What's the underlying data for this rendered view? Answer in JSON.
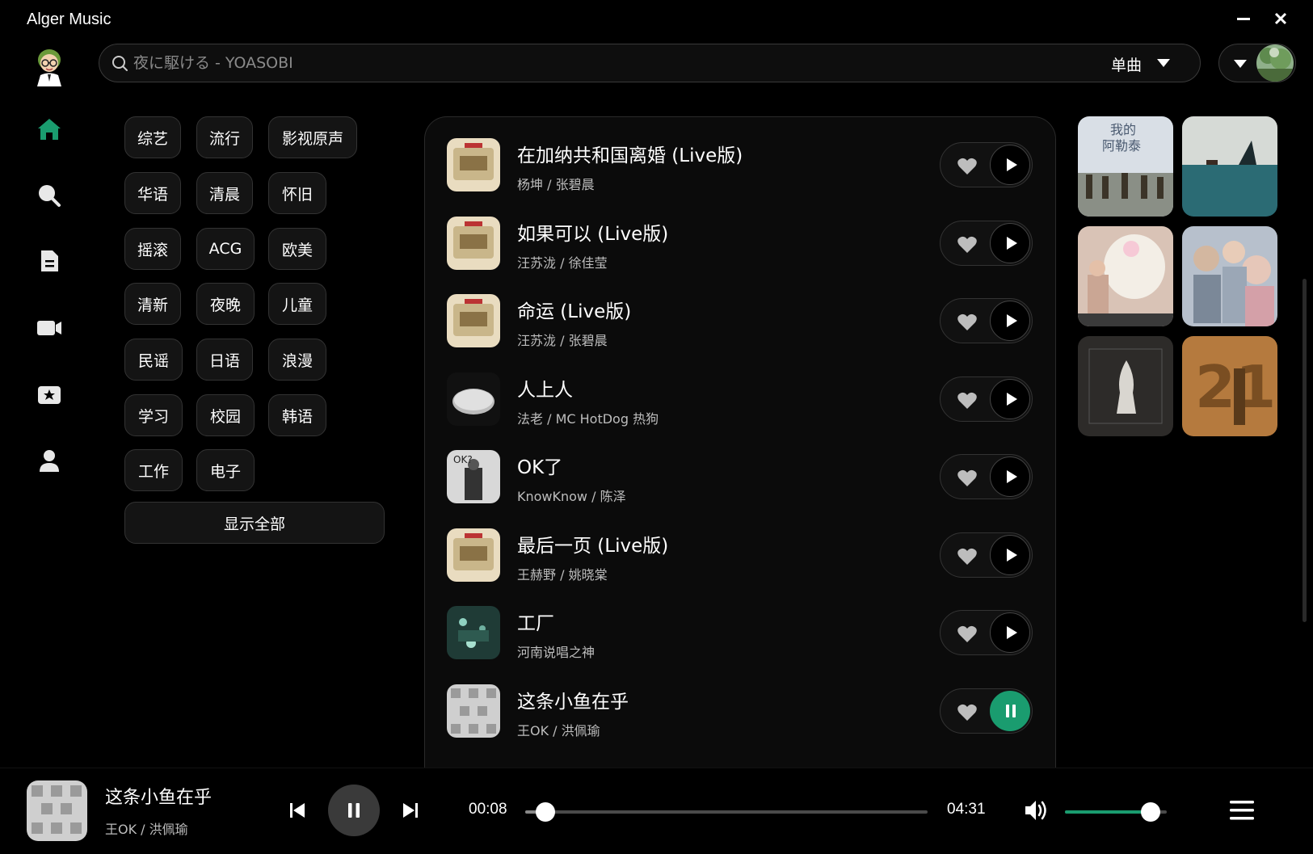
{
  "app": {
    "title": "Alger Music"
  },
  "search": {
    "placeholder": "夜に駆ける - YOASOBI",
    "type_label": "单曲"
  },
  "nav": {
    "items": [
      {
        "name": "home",
        "active": true
      },
      {
        "name": "search",
        "active": false
      },
      {
        "name": "playlist",
        "active": false
      },
      {
        "name": "mv",
        "active": false
      },
      {
        "name": "favorites",
        "active": false
      },
      {
        "name": "user",
        "active": false
      }
    ],
    "active_color": "#1a9c6f"
  },
  "tags": [
    "综艺",
    "流行",
    "影视原声",
    "华语",
    "清晨",
    "怀旧",
    "摇滚",
    "ACG",
    "欧美",
    "清新",
    "夜晚",
    "儿童",
    "民谣",
    "日语",
    "浪漫",
    "学习",
    "校园",
    "韩语",
    "工作",
    "电子"
  ],
  "show_all_label": "显示全部",
  "songs": [
    {
      "title": "在加纳共和国离婚 (Live版)",
      "artist": "杨坤 / 张碧晨",
      "playing": false
    },
    {
      "title": "如果可以 (Live版)",
      "artist": "汪苏泷 / 徐佳莹",
      "playing": false
    },
    {
      "title": "命运 (Live版)",
      "artist": "汪苏泷 / 张碧晨",
      "playing": false
    },
    {
      "title": "人上人",
      "artist": "法老 / MC HotDog 热狗",
      "playing": false
    },
    {
      "title": "OK了",
      "artist": "KnowKnow / 陈泽",
      "playing": false
    },
    {
      "title": "最后一页 (Live版)",
      "artist": "王赫野 / 姚晓棠",
      "playing": false
    },
    {
      "title": "工厂",
      "artist": "河南说唱之神",
      "playing": false
    },
    {
      "title": "这条小鱼在乎",
      "artist": "王OK / 洪佩瑜",
      "playing": true
    }
  ],
  "albums": [
    {
      "name": "album-a-letai"
    },
    {
      "name": "album-shark"
    },
    {
      "name": "album-reasonable-woman"
    },
    {
      "name": "album-anime-girls"
    },
    {
      "name": "album-tortured-poets"
    },
    {
      "name": "album-21"
    }
  ],
  "player": {
    "title": "这条小鱼在乎",
    "artist": "王OK / 洪佩瑜",
    "current_time": "00:08",
    "total_time": "04:31",
    "progress": 0.05,
    "volume": 0.84,
    "accent": "#1a9c6f"
  }
}
